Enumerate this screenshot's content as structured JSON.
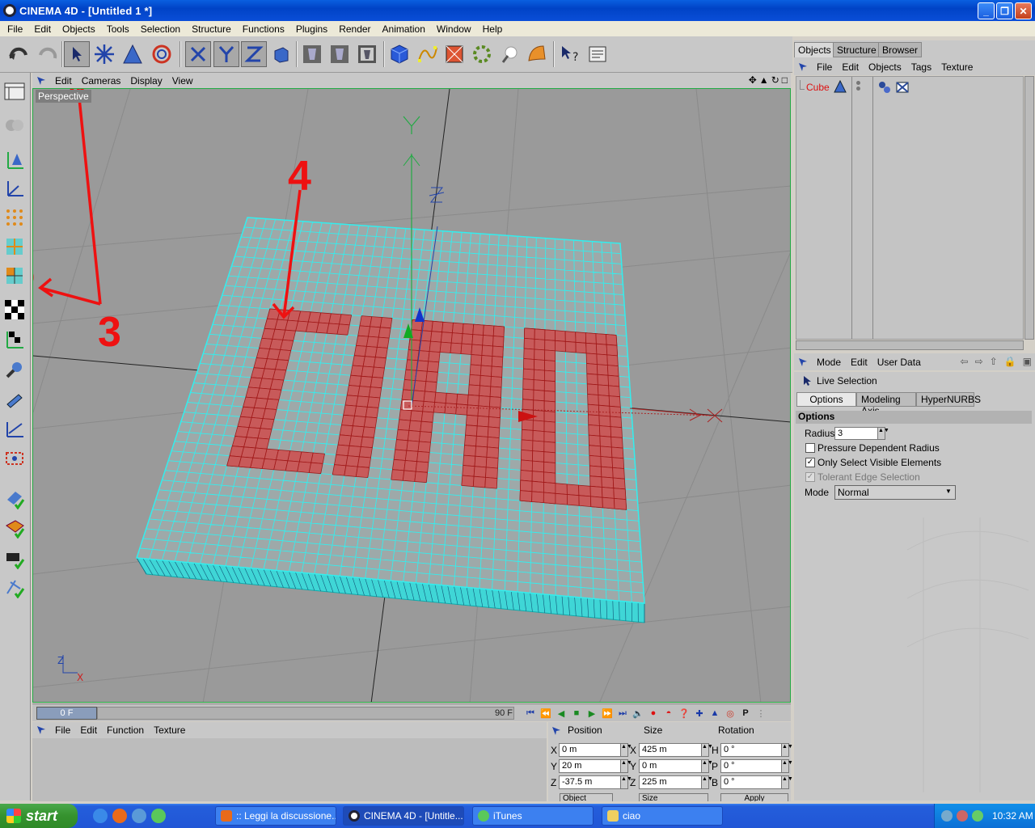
{
  "window": {
    "title": "CINEMA 4D - [Untitled 1 *]"
  },
  "menubar": [
    "File",
    "Edit",
    "Objects",
    "Tools",
    "Selection",
    "Structure",
    "Functions",
    "Plugins",
    "Render",
    "Animation",
    "Window",
    "Help"
  ],
  "viewport": {
    "menu": [
      "Edit",
      "Cameras",
      "Display",
      "View"
    ],
    "camera_label": "Perspective",
    "axis_labels": {
      "y": "Y",
      "z": "Z",
      "x": "X"
    },
    "annotations": {
      "label_3": "3",
      "label_4": "4"
    },
    "mesh_text": "CIAO"
  },
  "timeline": {
    "current_frame": "0 F",
    "end_frame": "90 F"
  },
  "material_manager": {
    "menu": [
      "File",
      "Edit",
      "Function",
      "Texture"
    ]
  },
  "coordinates": {
    "headers": {
      "position": "Position",
      "size": "Size",
      "rotation": "Rotation"
    },
    "rows": [
      {
        "axis": "X",
        "position": "0 m",
        "size_axis": "X",
        "size": "425 m",
        "rot_axis": "H",
        "rotation": "0 °"
      },
      {
        "axis": "Y",
        "position": "20 m",
        "size_axis": "Y",
        "size": "0 m",
        "rot_axis": "P",
        "rotation": "0 °"
      },
      {
        "axis": "Z",
        "position": "-37.5 m",
        "size_axis": "Z",
        "size": "225 m",
        "rot_axis": "B",
        "rotation": "0 °"
      }
    ],
    "bottom_labels": {
      "object": "Object",
      "size_mode": "Size",
      "apply": "Apply"
    }
  },
  "object_manager": {
    "tabs": [
      "Objects",
      "Structure",
      "Browser"
    ],
    "menu": [
      "File",
      "Edit",
      "Objects",
      "Tags",
      "Texture"
    ],
    "objects": [
      {
        "name": "Cube"
      }
    ]
  },
  "attribute_manager": {
    "menu": [
      "Mode",
      "Edit",
      "User Data"
    ],
    "tool_name": "Live Selection",
    "tabs": [
      "Options",
      "Modeling Axis",
      "HyperNURBS"
    ],
    "section": "Options",
    "radius_label": "Radius",
    "radius_value": "3",
    "checkboxes": [
      {
        "label": "Pressure Dependent Radius",
        "checked": false,
        "enabled": true
      },
      {
        "label": "Only Select Visible Elements",
        "checked": true,
        "enabled": true
      },
      {
        "label": "Tolerant Edge Selection",
        "checked": true,
        "enabled": false
      }
    ],
    "mode_label": "Mode",
    "mode_value": "Normal"
  },
  "taskbar": {
    "start_label": "start",
    "tasks": [
      ":: Leggi la discussione...",
      "CINEMA 4D - [Untitle...",
      "iTunes",
      "ciao"
    ],
    "clock": "10:32 AM"
  },
  "colors": {
    "selection_red": "#cc3333",
    "mesh_cyan": "#33e0e0",
    "xp_blue": "#245edb"
  }
}
